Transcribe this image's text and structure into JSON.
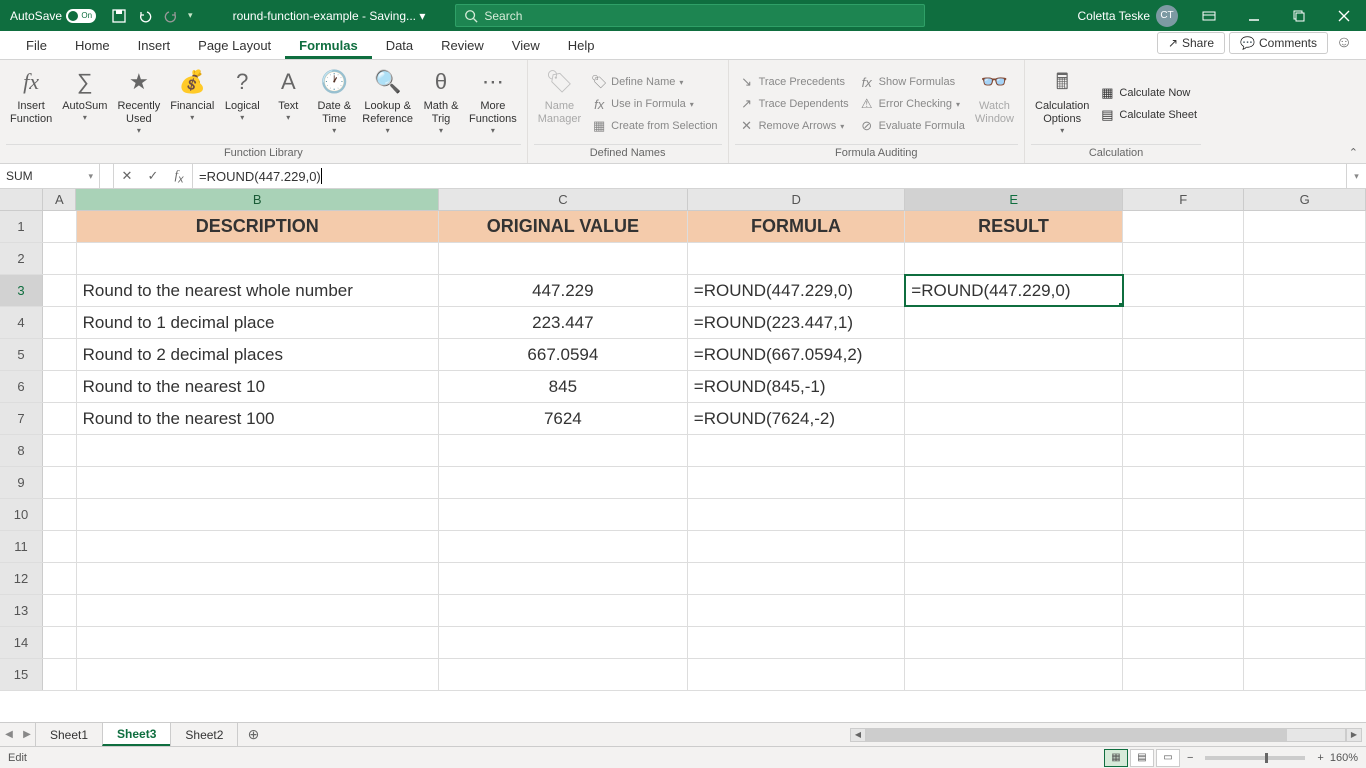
{
  "titlebar": {
    "autosave_label": "AutoSave",
    "autosave_state": "On",
    "doc_title": "round-function-example - Saving... ▾",
    "search_placeholder": "Search",
    "user_name": "Coletta Teske",
    "user_initials": "CT"
  },
  "tabs": {
    "items": [
      "File",
      "Home",
      "Insert",
      "Page Layout",
      "Formulas",
      "Data",
      "Review",
      "View",
      "Help"
    ],
    "active": "Formulas",
    "share": "Share",
    "comments": "Comments"
  },
  "ribbon": {
    "groups": {
      "function_library": {
        "label": "Function Library",
        "buttons": [
          "Insert\nFunction",
          "AutoSum",
          "Recently\nUsed",
          "Financial",
          "Logical",
          "Text",
          "Date &\nTime",
          "Lookup &\nReference",
          "Math &\nTrig",
          "More\nFunctions"
        ]
      },
      "defined_names": {
        "label": "Defined Names",
        "name_manager": "Name\nManager",
        "items": [
          "Define Name",
          "Use in Formula",
          "Create from Selection"
        ]
      },
      "formula_auditing": {
        "label": "Formula Auditing",
        "col1": [
          "Trace Precedents",
          "Trace Dependents",
          "Remove Arrows"
        ],
        "col2": [
          "Show Formulas",
          "Error Checking",
          "Evaluate Formula"
        ],
        "watch": "Watch\nWindow"
      },
      "calculation": {
        "label": "Calculation",
        "options": "Calculation\nOptions",
        "items": [
          "Calculate Now",
          "Calculate Sheet"
        ]
      }
    }
  },
  "formula_bar": {
    "name_box": "SUM",
    "formula": "=ROUND(447.229,0)"
  },
  "grid": {
    "columns": [
      "A",
      "B",
      "C",
      "D",
      "E",
      "F",
      "G"
    ],
    "headers": {
      "B": "DESCRIPTION",
      "C": "ORIGINAL VALUE",
      "D": "FORMULA",
      "E": "RESULT"
    },
    "rows": [
      {
        "n": 1
      },
      {
        "n": 2
      },
      {
        "n": 3,
        "B": "Round to the nearest whole number",
        "C": "447.229",
        "D": "=ROUND(447.229,0)",
        "E": "=ROUND(447.229,0)"
      },
      {
        "n": 4,
        "B": "Round to 1 decimal place",
        "C": "223.447",
        "D": "=ROUND(223.447,1)"
      },
      {
        "n": 5,
        "B": "Round to 2 decimal places",
        "C": "667.0594",
        "D": "=ROUND(667.0594,2)"
      },
      {
        "n": 6,
        "B": "Round to the nearest 10",
        "C": "845",
        "D": "=ROUND(845,-1)"
      },
      {
        "n": 7,
        "B": "Round to the nearest 100",
        "C": "7624",
        "D": "=ROUND(7624,-2)"
      },
      {
        "n": 8
      },
      {
        "n": 9
      },
      {
        "n": 10
      },
      {
        "n": 11
      },
      {
        "n": 12
      },
      {
        "n": 13
      },
      {
        "n": 14
      },
      {
        "n": 15
      }
    ],
    "active_cell": {
      "row": 3,
      "col": "E"
    }
  },
  "sheets": {
    "tabs": [
      "Sheet1",
      "Sheet3",
      "Sheet2"
    ],
    "active": "Sheet3"
  },
  "status": {
    "mode": "Edit",
    "zoom": "160%"
  }
}
